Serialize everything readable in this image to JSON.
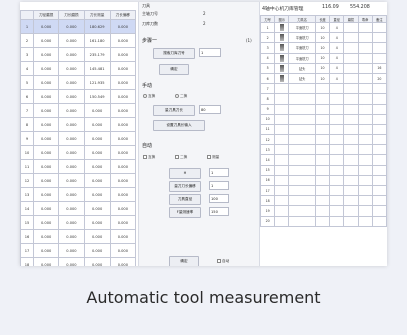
{
  "left_table": {
    "headers": [
      "",
      "刀径磨损",
      "刀长磨损",
      "刀长测量",
      "刀长偏移"
    ],
    "rows": [
      [
        "1",
        "0.000",
        "0.000",
        "180.629",
        "0.000"
      ],
      [
        "2",
        "0.000",
        "0.000",
        "161.180",
        "0.000"
      ],
      [
        "3",
        "0.000",
        "0.000",
        "235.179",
        "0.000"
      ],
      [
        "4",
        "0.000",
        "0.000",
        "145.481",
        "0.000"
      ],
      [
        "5",
        "0.000",
        "0.000",
        "121.935",
        "0.000"
      ],
      [
        "6",
        "0.000",
        "0.000",
        "150.549",
        "0.000"
      ],
      [
        "7",
        "0.000",
        "0.000",
        "0.000",
        "0.000"
      ],
      [
        "8",
        "0.000",
        "0.000",
        "0.000",
        "0.000"
      ],
      [
        "9",
        "0.000",
        "0.000",
        "0.000",
        "0.000"
      ],
      [
        "10",
        "0.000",
        "0.000",
        "0.000",
        "0.000"
      ],
      [
        "11",
        "0.000",
        "0.000",
        "0.000",
        "0.000"
      ],
      [
        "12",
        "0.000",
        "0.000",
        "0.000",
        "0.000"
      ],
      [
        "13",
        "0.000",
        "0.000",
        "0.000",
        "0.000"
      ],
      [
        "14",
        "0.000",
        "0.000",
        "0.000",
        "0.000"
      ],
      [
        "15",
        "0.000",
        "0.000",
        "0.000",
        "0.000"
      ],
      [
        "16",
        "0.000",
        "0.000",
        "0.000",
        "0.000"
      ],
      [
        "17",
        "0.000",
        "0.000",
        "0.000",
        "0.000"
      ],
      [
        "18",
        "0.000",
        "0.000",
        "0.000",
        "0.000"
      ],
      [
        "19",
        "0.000",
        "0.000",
        "0.000",
        "0.000"
      ]
    ],
    "selected_row": 0
  },
  "middle": {
    "top_header": "刀具",
    "spindle_tool_label": "主轴刀号",
    "spindle_tool_value": "2",
    "tool_count_label": "刀库刀数",
    "tool_count_value": "2",
    "section_step": "步骤一",
    "section_step_num": "(1)",
    "search_tool_button": "搜索刀库刀号",
    "search_tool_value": "1",
    "confirm_button": "确定",
    "section_manual": "手动",
    "radio_manual_a": "互换",
    "radio_manual_b": "二换",
    "manual_measure_button": "量刀具刀长",
    "manual_measure_value": "80",
    "manual_insert_button": "设置刀具长输入",
    "section_auto": "自动",
    "check_auto_a": "互换",
    "check_auto_b": "二换",
    "check_auto_c": "测量",
    "field_h_label": "H",
    "field_h_value": "1",
    "field_len_label": "量刀刀长偏移",
    "field_len_value": "1",
    "field_radius_label": "刀具直径",
    "field_radius_value": "100",
    "field_f_label": "F量测速率",
    "field_f_value": "150",
    "bottom_confirm": "确定",
    "bottom_check": "自动"
  },
  "right": {
    "title": "4轴中心机刀库管理",
    "value_a": "116.09",
    "value_b": "554.208",
    "headers": [
      "刀号",
      "图示",
      "刀具名",
      "长度",
      "直径",
      "磨损",
      "寿命",
      "备注"
    ],
    "rows": [
      [
        "1",
        "img",
        "平面铣刀",
        "10",
        "4",
        "",
        "",
        ""
      ],
      [
        "2",
        "img",
        "平面铣刀",
        "10",
        "4",
        "",
        "",
        ""
      ],
      [
        "3",
        "img",
        "平面铣刀",
        "10",
        "4",
        "",
        "",
        ""
      ],
      [
        "4",
        "img",
        "平面铣刀",
        "10",
        "4",
        "",
        "",
        ""
      ],
      [
        "5",
        "img",
        "钻头",
        "10",
        "4",
        "",
        "",
        "16"
      ],
      [
        "6",
        "img",
        "钻头",
        "10",
        "4",
        "",
        "",
        "20"
      ],
      [
        "7",
        "",
        "",
        "",
        "",
        "",
        "",
        ""
      ],
      [
        "8",
        "",
        "",
        "",
        "",
        "",
        "",
        ""
      ],
      [
        "9",
        "",
        "",
        "",
        "",
        "",
        "",
        ""
      ],
      [
        "10",
        "",
        "",
        "",
        "",
        "",
        "",
        ""
      ],
      [
        "11",
        "",
        "",
        "",
        "",
        "",
        "",
        ""
      ],
      [
        "12",
        "",
        "",
        "",
        "",
        "",
        "",
        ""
      ],
      [
        "13",
        "",
        "",
        "",
        "",
        "",
        "",
        ""
      ],
      [
        "14",
        "",
        "",
        "",
        "",
        "",
        "",
        ""
      ],
      [
        "15",
        "",
        "",
        "",
        "",
        "",
        "",
        ""
      ],
      [
        "16",
        "",
        "",
        "",
        "",
        "",
        "",
        ""
      ],
      [
        "17",
        "",
        "",
        "",
        "",
        "",
        "",
        ""
      ],
      [
        "18",
        "",
        "",
        "",
        "",
        "",
        "",
        ""
      ],
      [
        "19",
        "",
        "",
        "",
        "",
        "",
        "",
        ""
      ],
      [
        "20",
        "",
        "",
        "",
        "",
        "",
        "",
        ""
      ]
    ]
  },
  "caption": "Automatic tool measurement"
}
